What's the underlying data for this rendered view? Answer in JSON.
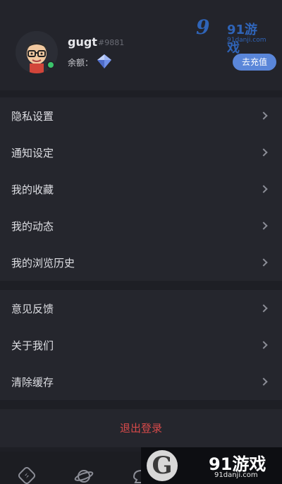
{
  "profile": {
    "username": "gugt",
    "user_id": "#9881",
    "balance_label": "余额：",
    "recharge_label": "去充值"
  },
  "watermark": {
    "text": "91游戏",
    "url": "91danji.com"
  },
  "menu": {
    "group1": [
      {
        "label": "隐私设置"
      },
      {
        "label": "通知设定"
      },
      {
        "label": "我的收藏"
      },
      {
        "label": "我的动态"
      },
      {
        "label": "我的浏览历史"
      }
    ],
    "group2": [
      {
        "label": "意见反馈"
      },
      {
        "label": "关于我们"
      },
      {
        "label": "清除缓存"
      }
    ]
  },
  "logout_label": "退出登录",
  "colors": {
    "background": "#1e1f25",
    "accent": "#5a86d9",
    "danger": "#d84a4a",
    "online": "#3bc46b"
  }
}
